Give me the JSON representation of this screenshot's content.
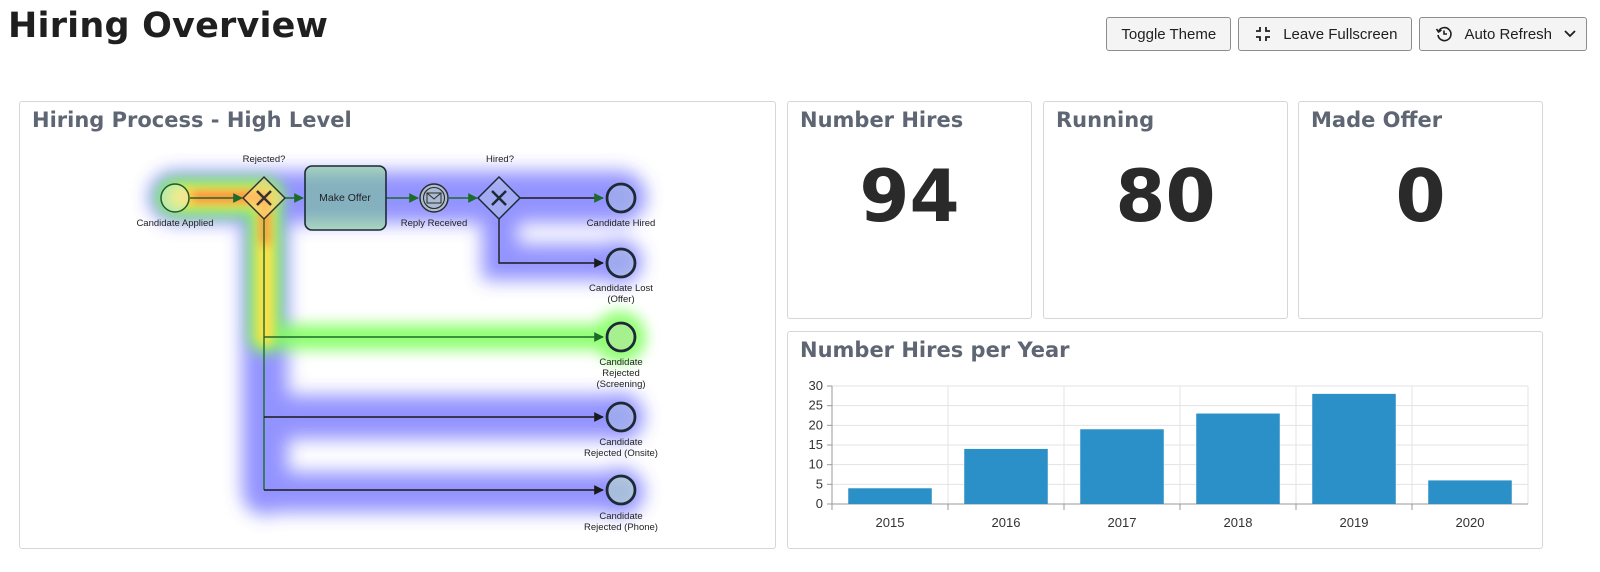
{
  "page": {
    "title": "Hiring Overview"
  },
  "toolbar": {
    "toggle_theme": "Toggle Theme",
    "leave_fullscreen": "Leave Fullscreen",
    "auto_refresh": "Auto Refresh"
  },
  "process_tile": {
    "title": "Hiring Process - High Level",
    "labels": {
      "rejected_q": "Rejected?",
      "hired_q": "Hired?",
      "make_offer": "Make Offer",
      "candidate_applied": "Candidate Applied",
      "reply_received": "Reply Received",
      "candidate_hired": "Candidate Hired",
      "lost_offer_1": "Candidate Lost",
      "lost_offer_2": "(Offer)",
      "rej_screening_1": "Candidate",
      "rej_screening_2": "Rejected",
      "rej_screening_3": "(Screening)",
      "rej_onsite_1": "Candidate",
      "rej_onsite_2": "Rejected (Onsite)",
      "rej_phone_1": "Candidate",
      "rej_phone_2": "Rejected (Phone)"
    }
  },
  "kpis": [
    {
      "title": "Number Hires",
      "value": "94"
    },
    {
      "title": "Running",
      "value": "80"
    },
    {
      "title": "Made Offer",
      "value": "0"
    }
  ],
  "colors": {
    "bar": "#2b90c8",
    "grid": "#e3e3e3",
    "title": "#5f6673"
  },
  "chart_data": {
    "type": "bar",
    "title": "Number Hires per Year",
    "categories": [
      "2015",
      "2016",
      "2017",
      "2018",
      "2019",
      "2020"
    ],
    "values": [
      4,
      14,
      19,
      23,
      28,
      6
    ],
    "ylim": [
      0,
      30
    ],
    "yticks": [
      "0",
      "5",
      "10",
      "15",
      "20",
      "25",
      "30"
    ],
    "grid": true
  }
}
